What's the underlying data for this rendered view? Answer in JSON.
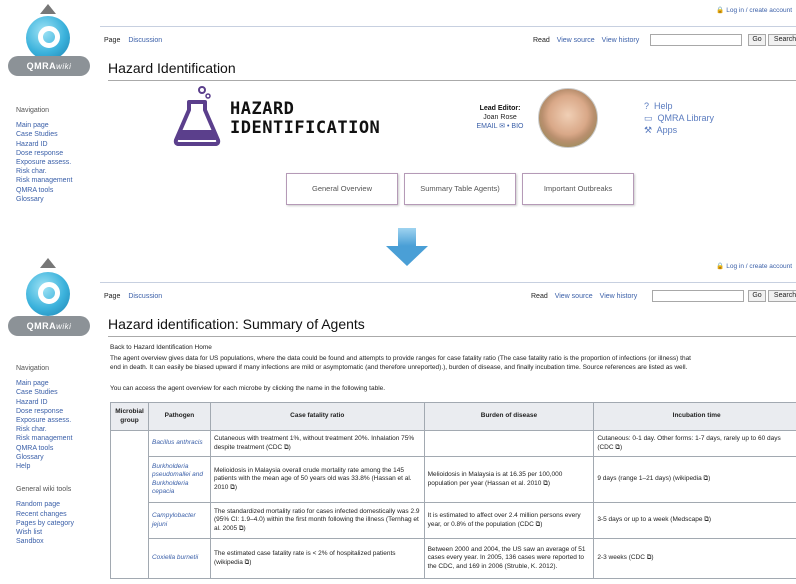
{
  "top": {
    "login": "Log in / create account",
    "tabs": [
      "Page",
      "Discussion"
    ],
    "views": [
      "Read",
      "View source",
      "View history"
    ],
    "go": "Go",
    "search": "Search",
    "logo_text": "QMRA",
    "logo_wiki": "wiki",
    "title": "Hazard Identification",
    "nav_heading": "Navigation",
    "nav": [
      "Main page",
      "Case Studies",
      "Hazard ID",
      "Dose response",
      "Exposure assess.",
      "Risk char.",
      "Risk management",
      "QMRA tools",
      "Glossary"
    ],
    "hazard_line1": "HAZARD",
    "hazard_line2": "IDENTIFICATION",
    "editor_label": "Lead Editor:",
    "editor_name": "Joan Rose",
    "editor_links": "EMAIL ✉ • BIO",
    "right_links": [
      "Help",
      "QMRA Library",
      "Apps"
    ],
    "buttons": [
      "General Overview",
      "Summary Table Agents)",
      "Important Outbreaks"
    ]
  },
  "bottom": {
    "login": "Log in / create account",
    "tabs": [
      "Page",
      "Discussion"
    ],
    "views": [
      "Read",
      "View source",
      "View history"
    ],
    "go": "Go",
    "search": "Search",
    "logo_text": "QMRA",
    "logo_wiki": "wiki",
    "title": "Hazard identification: Summary of Agents",
    "nav_heading": "Navigation",
    "nav": [
      "Main page",
      "Case Studies",
      "Hazard ID",
      "Dose response",
      "Exposure assess.",
      "Risk char.",
      "Risk management",
      "QMRA tools",
      "Glossary",
      "Help"
    ],
    "tools_heading": "General wiki tools",
    "tools": [
      "Random page",
      "Recent changes",
      "Pages by category",
      "Wish list",
      "Sandbox"
    ],
    "back_link": "Back to Hazard Identification Home",
    "intro1": "The agent overview gives data for US populations, where the data could be found and attempts to provide ranges for case fatality ratio (The case fatality ratio is the proportion of infections (or illness) that",
    "intro2": "end in death. It can easily be biased upward if many infections are mild or asymptomatic (and therefore unreported).), burden of disease, and finally incubation time. Source references are listed as well.",
    "intro3": "You can access the agent overview for each microbe by clicking the name in the following table.",
    "table": {
      "headers": [
        "Microbial group",
        "Pathogen",
        "Case fatality ratio",
        "Burden of disease",
        "Incubation time"
      ],
      "rows": [
        {
          "pathogen": "Bacillus anthracis",
          "cfr": "Cutaneous with treatment 1%, without treatment 20%. Inhalation 75% despite treatment (CDC ⧉)",
          "burden": "",
          "incubation": "Cutaneous: 0-1 day. Other forms: 1-7 days, rarely up to 60 days (CDC ⧉)"
        },
        {
          "pathogen": "Burkholderia pseudomallei and Burkholderia cepacia",
          "cfr": "Melioidosis in Malaysia overall crude mortality rate among the 145 patients with the mean age of 50 years old was 33.8% (Hassan et al. 2010 ⧉)",
          "burden": "Melioidosis in Malaysia is at 16.35 per 100,000 population per year (Hassan et al. 2010 ⧉)",
          "incubation": "9 days (range 1–21 days) (wikipedia ⧉)"
        },
        {
          "pathogen": "Campylobacter jejuni",
          "cfr": "The standardized mortality ratio for cases infected domestically was 2.9 (95% CI: 1.9–4.0) within the first month following the illness (Ternhag et al. 2005 ⧉)",
          "burden": "It is estimated to affect over 2.4 million persons every year, or 0.8% of the population (CDC ⧉)",
          "incubation": "3-5 days or up to a week (Medscape ⧉)"
        },
        {
          "pathogen": "Coxiella burnetii",
          "cfr": "The estimated case fatality rate is < 2% of hospitalized patients (wikipedia ⧉)",
          "burden": "Between 2000 and 2004, the US saw an average of 51 cases every year. In 2005, 136 cases were reported to the CDC, and 169 in 2006 (Struble, K. 2012).",
          "incubation": "2-3 weeks (CDC ⧉)"
        }
      ]
    }
  }
}
